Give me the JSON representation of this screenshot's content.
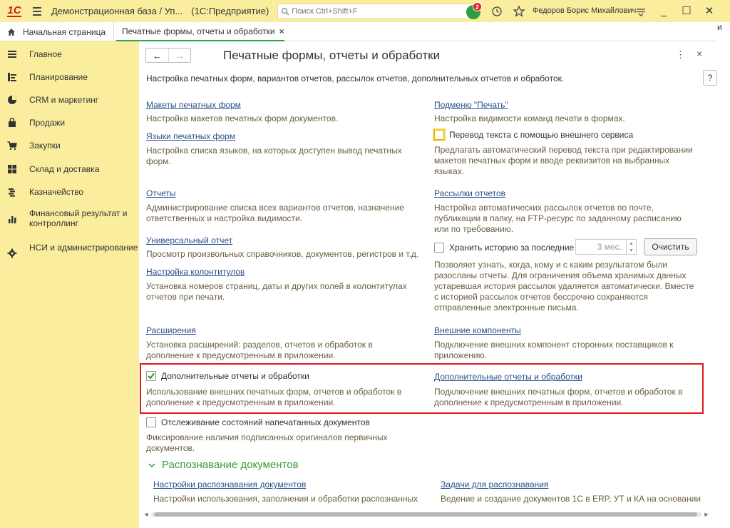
{
  "titlebar": {
    "app_title": "Демонстрационная база / Уп...",
    "app_subtitle": "(1С:Предприятие)",
    "search_placeholder": "Поиск Ctrl+Shift+F",
    "notification_count": "2",
    "user_name": "Федоров Борис Михайлович",
    "logo_text": "1С"
  },
  "tabs": {
    "home_label": "Начальная страница",
    "active_label": "Печатные формы, отчеты и обработки",
    "close_symbol": "×"
  },
  "right_strip_text": "и",
  "sidebar": {
    "items": [
      {
        "label": "Главное",
        "icon": "menu-lines-icon"
      },
      {
        "label": "Планирование",
        "icon": "planning-icon"
      },
      {
        "label": "CRM и маркетинг",
        "icon": "pie-chart-icon"
      },
      {
        "label": "Продажи",
        "icon": "shopping-bag-icon"
      },
      {
        "label": "Закупки",
        "icon": "cart-icon"
      },
      {
        "label": "Склад и доставка",
        "icon": "warehouse-icon"
      },
      {
        "label": "Казначейство",
        "icon": "coins-icon"
      },
      {
        "label": "Финансовый результат и контроллинг",
        "icon": "bar-chart-icon"
      },
      {
        "label": "НСИ и администрирование",
        "icon": "gear-icon"
      }
    ]
  },
  "page": {
    "title": "Печатные формы, отчеты и обработки",
    "description": "Настройка печатных форм, вариантов отчетов, рассылок отчетов, дополнительных отчетов и обработок.",
    "help_label": "?",
    "more_label": "⋮",
    "close_label": "×"
  },
  "left": {
    "print_layouts": {
      "link": "Макеты печатных форм",
      "desc": "Настройка макетов печатных форм документов."
    },
    "print_languages": {
      "link": "Языки печатных форм",
      "desc": "Настройка списка языков, на которых доступен вывод печатных форм."
    },
    "reports": {
      "link": "Отчеты",
      "desc": "Администрирование списка всех вариантов отчетов, назначение ответственных и настройка видимости."
    },
    "universal_report": {
      "link": "Универсальный отчет",
      "desc": "Просмотр произвольных справочников, документов, регистров и т.д."
    },
    "headers_footers": {
      "link": "Настройка колонтитулов",
      "desc": "Установка номеров страниц, даты и других полей в колонтитулах отчетов при печати."
    },
    "extensions": {
      "link": "Расширения",
      "desc": "Установка расширений: разделов, отчетов и обработок в дополнение к предусмотренным в приложении."
    },
    "additional_reports_check": {
      "label": "Дополнительные отчеты и обработки",
      "checked": true,
      "desc": "Использование внешних печатных форм, отчетов и обработок в дополнение к предусмотренным в приложении."
    },
    "tracking_check": {
      "label": "Отслеживание состояний напечатанных документов",
      "checked": false,
      "desc": "Фиксирование наличия подписанных оригиналов первичных документов."
    }
  },
  "right": {
    "print_submenu": {
      "link": "Подменю \"Печать\"",
      "desc": "Настройка видимости команд печати в формах."
    },
    "translation_check": {
      "label": "Перевод текста с помощью внешнего сервиса",
      "checked": false,
      "desc": "Предлагать автоматический перевод текста при редактировании макетов печатных форм и вводе реквизитов на выбранных языках."
    },
    "mailings": {
      "link": "Рассылки отчетов",
      "desc": "Настройка автоматических рассылок отчетов по почте, публикации в папку, на FTP-ресурс по заданному расписанию или по требованию."
    },
    "history_check": {
      "label": "Хранить историю за последние",
      "checked": false,
      "value": "3 мес.",
      "clear_label": "Очистить",
      "desc": "Позволяет узнать, когда, кому и с каким результатом были разосланы отчеты. Для ограничения объема хранимых данных устаревшая история рассылок удаляется автоматически. Вместе с историей рассылок отчетов бессрочно сохраняются отправленные электронные письма."
    },
    "external_components": {
      "link": "Внешние компоненты",
      "desc": "Подключение внешних компонент сторонних поставщиков к приложению."
    },
    "additional_reports_link": {
      "link": "Дополнительные отчеты и обработки",
      "desc": "Подключение внешних печатных форм, отчетов и обработок в дополнение к предусмотренным в приложении."
    }
  },
  "recognition": {
    "group_title": "Распознавание документов",
    "settings": {
      "link": "Настройки распознавания документов",
      "desc": "Настройки использования, заполнения и обработки распознанных"
    },
    "tasks": {
      "link": "Задачи для распознавания",
      "desc": "Ведение и создание документов 1С в ERP, УТ и КА на основании"
    }
  },
  "colors": {
    "accent_yellow": "#fbed9e",
    "link_blue": "#2a4e8c",
    "highlight_red": "#e01818",
    "group_green": "#3a9a3a"
  }
}
